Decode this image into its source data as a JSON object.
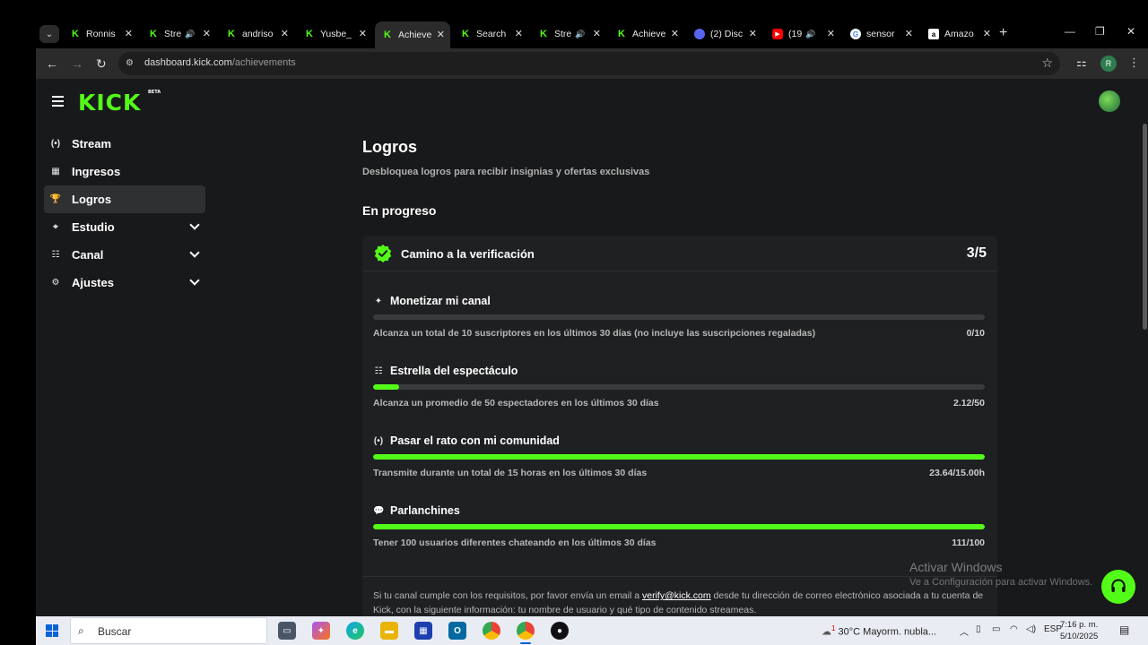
{
  "browser": {
    "tabs": [
      {
        "title": "Ronnis",
        "fav": "K",
        "favclass": "k"
      },
      {
        "title": "Stre",
        "fav": "K",
        "favclass": "k",
        "sound": true
      },
      {
        "title": "andriso",
        "fav": "K",
        "favclass": "k"
      },
      {
        "title": "Yusbe_",
        "fav": "K",
        "favclass": "k"
      },
      {
        "title": "Achieve",
        "fav": "K",
        "favclass": "k",
        "active": true
      },
      {
        "title": "Search",
        "fav": "K",
        "favclass": "k"
      },
      {
        "title": "Stre",
        "fav": "K",
        "favclass": "k",
        "sound": true
      },
      {
        "title": "Achieve",
        "fav": "K",
        "favclass": "k"
      },
      {
        "title": "(2) Disc",
        "fav": "",
        "favclass": "ds"
      },
      {
        "title": "(19",
        "fav": "▶",
        "favclass": "yt",
        "sound": true
      },
      {
        "title": "sensor",
        "fav": "G",
        "favclass": "g"
      },
      {
        "title": "Amazo",
        "fav": "a",
        "favclass": "a"
      }
    ],
    "url_host": "dashboard.kick.com",
    "url_path": "/achievements",
    "profile_initial": "R"
  },
  "sidebar": {
    "items": [
      {
        "label": "Stream",
        "icon": "broadcast-icon",
        "glyph": "(•)"
      },
      {
        "label": "Ingresos",
        "icon": "chart-icon",
        "glyph": "▦"
      },
      {
        "label": "Logros",
        "icon": "trophy-icon",
        "glyph": "🏆",
        "active": true
      },
      {
        "label": "Estudio",
        "icon": "studio-icon",
        "glyph": "⌖",
        "chevron": true
      },
      {
        "label": "Canal",
        "icon": "channel-icon",
        "glyph": "☷",
        "chevron": true
      },
      {
        "label": "Ajustes",
        "icon": "gear-icon",
        "glyph": "⚙",
        "chevron": true
      }
    ]
  },
  "main": {
    "title": "Logros",
    "subtitle": "Desbloquea logros para recibir insignias y ofertas exclusivas",
    "section": "En progreso",
    "card": {
      "title": "Camino a la verificación",
      "count": "3/5",
      "achievements": [
        {
          "name": "Monetizar mi canal",
          "glyph": "✦",
          "icon": "sparkle-icon",
          "desc": "Alcanza un total de 10 suscriptores en los últimos 30 días (no incluye las suscripciones regaladas)",
          "progress_text": "0/10",
          "progress": 0.0
        },
        {
          "name": "Estrella del espectáculo",
          "glyph": "☷",
          "icon": "viewers-icon",
          "desc": "Alcanza un promedio de 50 espectadores en los últimos 30 días",
          "progress_text": "2.12/50",
          "progress": 0.042
        },
        {
          "name": "Pasar el rato con mi comunidad",
          "glyph": "(•)",
          "icon": "broadcast-icon",
          "desc": "Transmite durante un total de 15 horas en los últimos 30 días",
          "progress_text": "23.64/15.00h",
          "progress": 1.0
        },
        {
          "name": "Parlanchines",
          "glyph": "💬",
          "icon": "chat-icon",
          "desc": "Tener 100 usuarios diferentes chateando en los últimos 30 días",
          "progress_text": "111/100",
          "progress": 1.0
        }
      ],
      "footer_before": "Si tu canal cumple con los requisitos, por favor envía un email a ",
      "footer_email": "verify@kick.com",
      "footer_after": " desde tu dirección de correo electrónico asociada a tu cuenta de Kick, con la siguiente información: tu nombre de usuario y qué tipo de contenido streameas."
    }
  },
  "watermark": {
    "line1": "Activar Windows",
    "line2": "Ve a Configuración para activar Windows."
  },
  "taskbar": {
    "search_placeholder": "Buscar",
    "weather": "30°C  Mayorm. nubla...",
    "weather_badge": "1",
    "lang": "ESP",
    "time": "7:16 p. m.",
    "date": "5/10/2025"
  },
  "colors": {
    "accent": "#53fc18",
    "background": "#18191b",
    "card": "#1f2022"
  }
}
